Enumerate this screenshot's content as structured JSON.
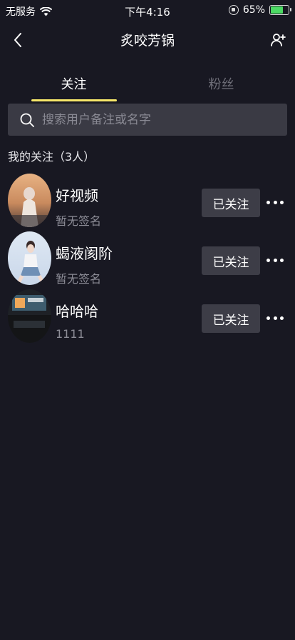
{
  "status_bar": {
    "carrier": "无服务",
    "time": "下午4:16",
    "battery": "65%",
    "battery_level": 0.65,
    "icons": [
      "wifi-icon",
      "orientation-lock-icon",
      "battery-charging-icon"
    ]
  },
  "nav": {
    "title": "炙咬芳锅",
    "back_icon": "chevron-left-icon",
    "action_icon": "add-friend-icon"
  },
  "tabs": [
    {
      "label": "关注",
      "active": true
    },
    {
      "label": "粉丝",
      "active": false
    }
  ],
  "search": {
    "placeholder": "搜索用户备注或名字"
  },
  "section_title": "我的关注（3人）",
  "users": [
    {
      "name": "好视频",
      "signature": "暂无签名",
      "button": "已关注"
    },
    {
      "name": "蝎液阂阶",
      "signature": "暂无签名",
      "button": "已关注"
    },
    {
      "name": "哈哈哈",
      "signature": "1111",
      "button": "已关注"
    }
  ],
  "colors": {
    "background": "#181822",
    "accent": "#f7e86a",
    "button": "#3d3d47",
    "search_bg": "#3a3a44"
  }
}
